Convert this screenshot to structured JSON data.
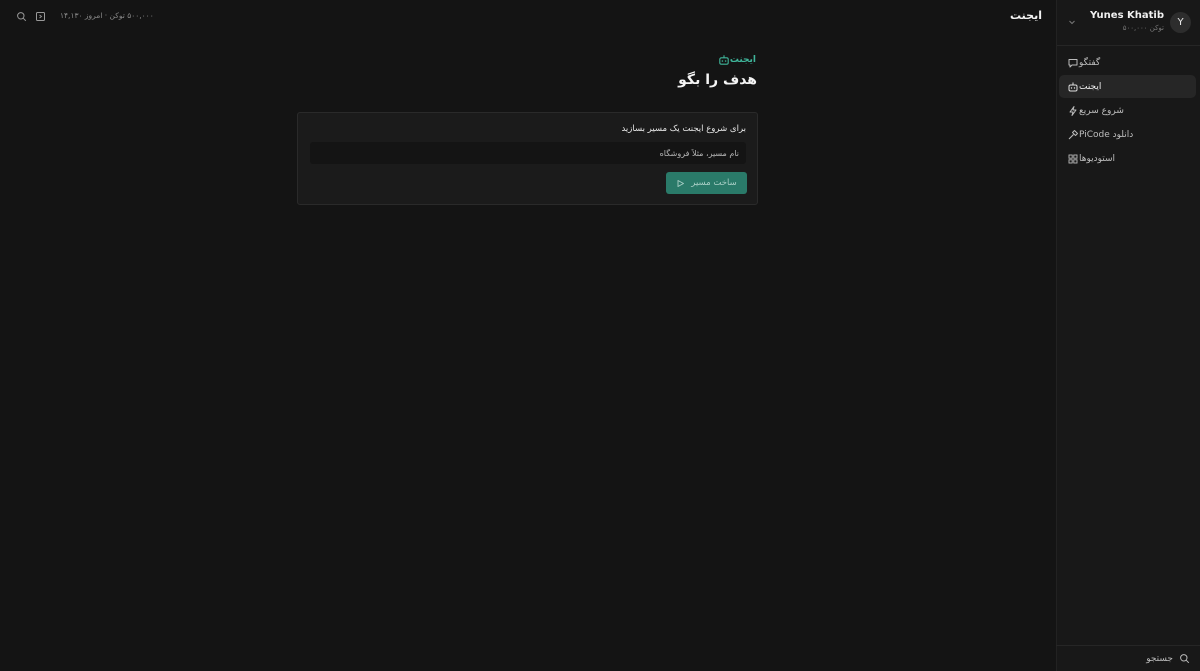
{
  "sidebar": {
    "user": {
      "avatar_letter": "Y",
      "name": "Yunes Khatib",
      "tokens": "۵۰۰,۰۰۰ توکن"
    },
    "items": [
      {
        "label": "گفتگو",
        "icon": "chat-icon",
        "active": false
      },
      {
        "label": "ایجنت",
        "icon": "robot-icon",
        "active": true
      },
      {
        "label": "شروع سریع",
        "icon": "lightning-icon",
        "active": false
      },
      {
        "label": "دانلود PiCode",
        "icon": "hammer-icon",
        "active": false
      },
      {
        "label": "استودیوها",
        "icon": "grid-icon",
        "active": false
      }
    ],
    "footer": {
      "label": "جستجو",
      "icon": "search-icon"
    }
  },
  "topbar": {
    "title": "ایجنت",
    "status": "۵۰۰,۰۰۰ توکن · امروز ۱۴,۱۳۰"
  },
  "main": {
    "tag": "ایجنت",
    "title": "هدف را بگو",
    "card": {
      "label": "برای شروع ایجنت یک مسیر بسازید",
      "input_placeholder": "نام مسیر، مثلاً فروشگاه",
      "input_value": "",
      "button_label": "ساخت مسیر"
    }
  },
  "colors": {
    "accent": "#3fb59a",
    "button_bg": "#2a7a69",
    "background": "#141414",
    "sidebar_bg": "#181818"
  }
}
